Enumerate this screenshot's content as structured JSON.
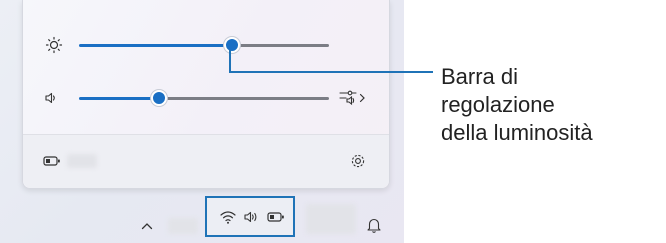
{
  "quick_settings": {
    "brightness": {
      "icon": "brightness-sun-icon",
      "level_percent": 61
    },
    "volume": {
      "icon": "speaker-icon",
      "level_percent": 32,
      "extra_icon": "audio-output-icon"
    },
    "footer": {
      "battery_icon": "battery-icon",
      "settings_icon": "settings-gear-icon"
    }
  },
  "taskbar": {
    "chevron_icon": "chevron-up-icon",
    "tray_icons": [
      "wifi-icon",
      "speaker-icon",
      "battery-icon"
    ],
    "notification_icon": "bell-icon"
  },
  "callout": {
    "lines": [
      "Barra di",
      "regolazione",
      "della luminosità"
    ]
  },
  "colors": {
    "accent": "#1a6fc4",
    "highlight": "#1f73b7"
  }
}
